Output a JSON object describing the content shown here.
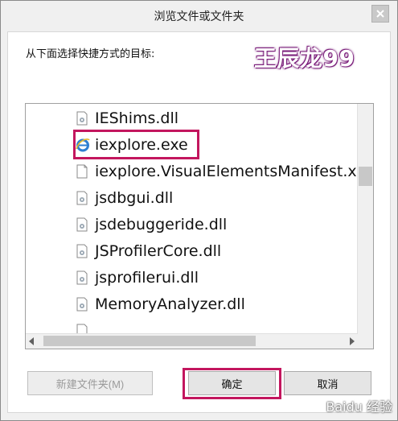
{
  "window": {
    "title": "浏览文件或文件夹"
  },
  "dialog": {
    "instruction": "从下面选择快捷方式的目标:"
  },
  "watermark": {
    "text": "王辰龙99"
  },
  "files": [
    {
      "name": "IEShims.dll",
      "icon": "dll-icon"
    },
    {
      "name": "iexplore.exe",
      "icon": "ie-icon"
    },
    {
      "name": "iexplore.VisualElementsManifest.x",
      "icon": "document-icon"
    },
    {
      "name": "jsdbgui.dll",
      "icon": "dll-icon"
    },
    {
      "name": "jsdebuggeride.dll",
      "icon": "dll-icon"
    },
    {
      "name": "JSProfilerCore.dll",
      "icon": "dll-icon"
    },
    {
      "name": "jsprofilerui.dll",
      "icon": "dll-icon"
    },
    {
      "name": "MemoryAnalyzer.dll",
      "icon": "dll-icon"
    }
  ],
  "buttons": {
    "new_folder": "新建文件夹(M)",
    "ok": "确定",
    "cancel": "取消"
  },
  "logo": {
    "text": "Baidu 经验"
  },
  "colors": {
    "highlight": "#c3165e",
    "watermark_stroke": "#7b1f7b"
  }
}
